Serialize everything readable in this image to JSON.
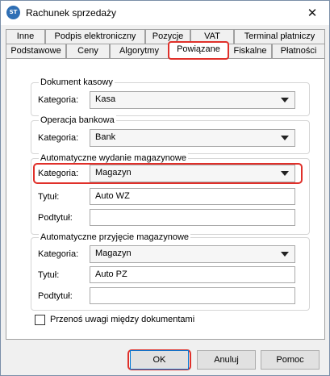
{
  "window": {
    "title": "Rachunek sprzedaży",
    "icon": "app-logo-icon",
    "close_symbol": "✕"
  },
  "tabs_row1": [
    "Inne",
    "Podpis elektroniczny",
    "Pozycje",
    "VAT",
    "Terminal płatniczy"
  ],
  "tabs_row2": [
    "Podstawowe",
    "Ceny",
    "Algorytmy",
    "Powiązane",
    "Fiskalne",
    "Płatności"
  ],
  "active_tab": "Powiązane",
  "sections": {
    "cash_document": {
      "title": "Dokument kasowy",
      "category_label": "Kategoria:",
      "category_value": "Kasa"
    },
    "bank_operation": {
      "title": "Operacja bankowa",
      "category_label": "Kategoria:",
      "category_value": "Bank"
    },
    "auto_issue": {
      "title": "Automatyczne wydanie magazynowe",
      "category_label": "Kategoria:",
      "category_value": "Magazyn",
      "title_label": "Tytuł:",
      "title_value": "Auto WZ",
      "subtitle_label": "Podtytuł:",
      "subtitle_value": ""
    },
    "auto_receipt": {
      "title": "Automatyczne przyjęcie magazynowe",
      "category_label": "Kategoria:",
      "category_value": "Magazyn",
      "title_label": "Tytuł:",
      "title_value": "Auto PZ",
      "subtitle_label": "Podtytuł:",
      "subtitle_value": ""
    }
  },
  "transfer_notes": {
    "label": "Przenoś uwagi między dokumentami",
    "checked": false
  },
  "buttons": {
    "ok": "OK",
    "cancel": "Anuluj",
    "help": "Pomoc"
  },
  "colors": {
    "highlight": "#e0302a",
    "accent": "#0078d7"
  }
}
